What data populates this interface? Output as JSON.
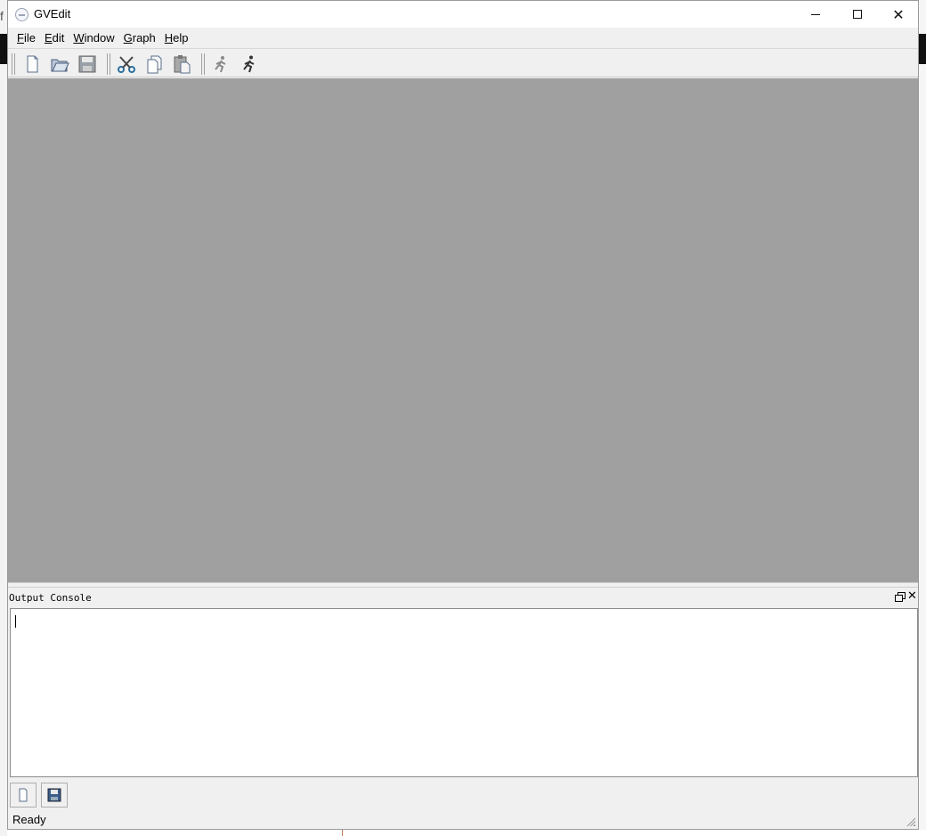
{
  "window": {
    "title": "GVEdit"
  },
  "menu": {
    "items": [
      {
        "label": "File"
      },
      {
        "label": "Edit"
      },
      {
        "label": "Window"
      },
      {
        "label": "Graph"
      },
      {
        "label": "Help"
      }
    ]
  },
  "toolbar": {
    "buttons": [
      {
        "name": "new-file",
        "icon": "new-file-icon"
      },
      {
        "name": "open-file",
        "icon": "open-folder-icon"
      },
      {
        "name": "save-file",
        "icon": "save-icon"
      },
      {
        "name": "cut",
        "icon": "scissors-icon"
      },
      {
        "name": "copy",
        "icon": "copy-icon"
      },
      {
        "name": "paste",
        "icon": "paste-icon"
      },
      {
        "name": "layout",
        "icon": "runner-settings-icon"
      },
      {
        "name": "run",
        "icon": "runner-icon"
      }
    ]
  },
  "console": {
    "title": "Output Console",
    "value": ""
  },
  "console_buttons": [
    {
      "name": "new-console",
      "icon": "new-file-icon"
    },
    {
      "name": "save-console",
      "icon": "save-icon"
    }
  ],
  "status": {
    "text": "Ready"
  },
  "colors": {
    "mdi_background": "#a0a0a0",
    "chrome": "#f0f0f0"
  }
}
